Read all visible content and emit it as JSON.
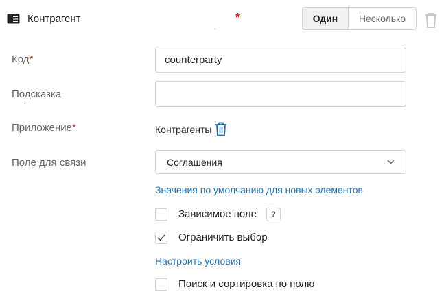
{
  "header": {
    "field_name": "Контрагент",
    "required_mark": "*",
    "mode_options": [
      {
        "label": "Один",
        "active": true
      },
      {
        "label": "Несколько",
        "active": false
      }
    ]
  },
  "form": {
    "code": {
      "label": "Код",
      "required_mark": "*",
      "value": "counterparty"
    },
    "hint": {
      "label": "Подсказка",
      "value": ""
    },
    "app": {
      "label": "Приложение",
      "required_mark": "*",
      "value": "Контрагенты"
    },
    "link_field": {
      "label": "Поле для связи",
      "selected": "Соглашения"
    },
    "defaults_link": "Значения по умолчанию для новых элементов",
    "dependent_field": {
      "label": "Зависимое поле",
      "checked": false,
      "help": "?"
    },
    "restrict_choice": {
      "label": "Ограничить выбор",
      "checked": true
    },
    "configure_conditions_link": "Настроить условия",
    "search_sort": {
      "label": "Поиск и сортировка по полю",
      "checked": false
    }
  },
  "colors": {
    "accent": "#1f6fa8",
    "required": "#dd2222",
    "border": "#cfd3d8",
    "label": "#666666"
  },
  "icons": [
    "field-type-icon",
    "trash-icon",
    "chevron-down-icon",
    "check-icon",
    "help-icon"
  ]
}
